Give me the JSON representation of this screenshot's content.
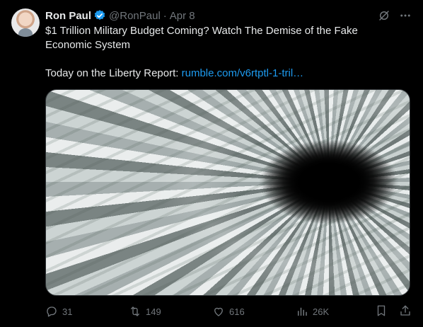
{
  "tweet": {
    "author_name": "Ron Paul",
    "author_handle": "@RonPaul",
    "separator": "·",
    "date": "Apr 8",
    "text_line1": "$1 Trillion Military Budget Coming? Watch The Demise of the Fake Economic System",
    "text_line2_prefix": "Today on the Liberty Report: ",
    "link_text": "rumble.com/v6rtptl-1-tril…"
  },
  "stats": {
    "replies": "31",
    "retweets": "149",
    "likes": "616",
    "views": "26K"
  },
  "colors": {
    "background": "#000000",
    "text": "#e7e9ea",
    "muted": "#71767b",
    "link": "#1d9bf0",
    "verified": "#1d9bf0"
  },
  "icons": [
    "verified-badge-icon",
    "grok-icon",
    "more-icon",
    "reply-icon",
    "retweet-icon",
    "like-icon",
    "views-icon",
    "bookmark-icon",
    "share-icon"
  ]
}
